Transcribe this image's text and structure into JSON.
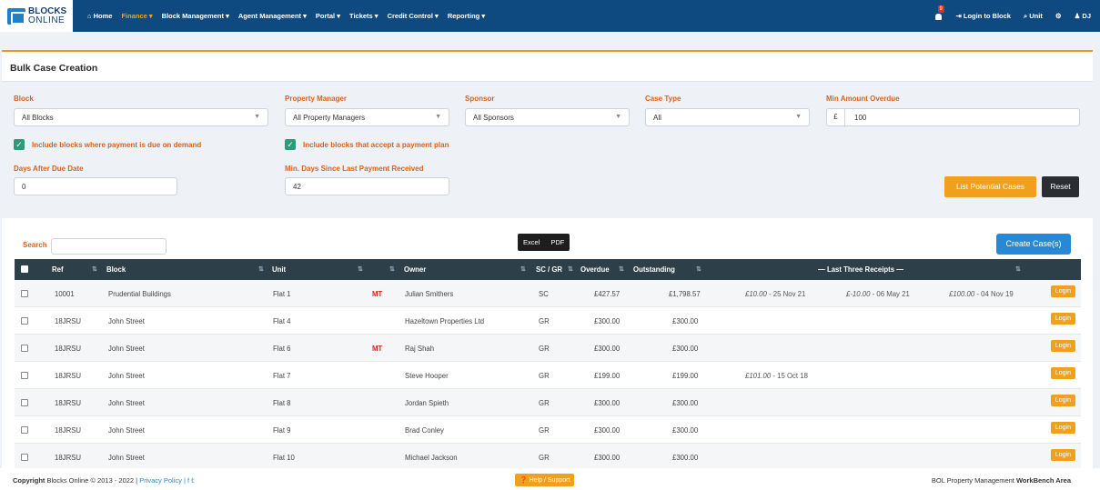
{
  "nav": {
    "logo_line1": "BLOCKS",
    "logo_line2": "ONLINE",
    "items": [
      "⌂ Home",
      "Finance ▾",
      "Block Management ▾",
      "Agent Management ▾",
      "Portal ▾",
      "Tickets ▾",
      "Credit Control ▾",
      "Reporting ▾"
    ],
    "notification_count": "9",
    "login_to_block": "⇥ Login to Block",
    "unit_search": "⌕ Unit",
    "settings": "⚙",
    "user": "♟ DJ"
  },
  "page": {
    "title": "Bulk Case Creation"
  },
  "filters": {
    "block_label": "Block",
    "block_value": "All Blocks",
    "pm_label": "Property Manager",
    "pm_value": "All Property Managers",
    "sponsor_label": "Sponsor",
    "sponsor_value": "All Sponsors",
    "case_type_label": "Case Type",
    "case_type_value": "All",
    "min_amount_label": "Min Amount Overdue",
    "currency": "£",
    "min_amount_value": "100",
    "check_demand": "Include blocks where payment is due on demand",
    "check_plan": "Include blocks that accept a payment plan",
    "days_due_label": "Days After Due Date",
    "days_due_value": "0",
    "min_days_label": "Min. Days Since Last Payment Received",
    "min_days_value": "42",
    "list_button": "List Potential Cases",
    "reset_button": "Reset"
  },
  "table_tools": {
    "search_label": "Search",
    "excel": "Excel",
    "pdf": "PDF",
    "create_button": "Create Case(s)"
  },
  "table": {
    "headers": {
      "ref": "Ref",
      "block": "Block",
      "unit": "Unit",
      "owner": "Owner",
      "scgr": "SC / GR",
      "overdue": "Overdue",
      "outstanding": "Outstanding",
      "receipts": "— Last Three Receipts —"
    },
    "login_label": "Login",
    "rows": [
      {
        "ref": "10001",
        "block": "Prudential Buildings",
        "unit": "Flat 1",
        "mt": "MT",
        "owner": "Julian Smithers",
        "scgr": "SC",
        "overdue": "£427.57",
        "outstanding": "£1,798.57",
        "r1a": "£10.00",
        "r1b": " - 25 Nov 21",
        "r2a": "£-10.00",
        "r2b": " - 06 May 21",
        "r3a": "£100.00",
        "r3b": " - 04 Nov 19"
      },
      {
        "ref": "18JRSU",
        "block": "John Street",
        "unit": "Flat 4",
        "mt": "",
        "owner": "Hazeltown Properties Ltd",
        "scgr": "GR",
        "overdue": "£300.00",
        "outstanding": "£300.00",
        "r1a": "",
        "r1b": "",
        "r2a": "",
        "r2b": "",
        "r3a": "",
        "r3b": ""
      },
      {
        "ref": "18JRSU",
        "block": "John Street",
        "unit": "Flat 6",
        "mt": "MT",
        "owner": "Raj Shah",
        "scgr": "GR",
        "overdue": "£300.00",
        "outstanding": "£300.00",
        "r1a": "",
        "r1b": "",
        "r2a": "",
        "r2b": "",
        "r3a": "",
        "r3b": ""
      },
      {
        "ref": "18JRSU",
        "block": "John Street",
        "unit": "Flat 7",
        "mt": "",
        "owner": "Steve Hooper",
        "scgr": "GR",
        "overdue": "£199.00",
        "outstanding": "£199.00",
        "r1a": "£101.00",
        "r1b": " - 15 Oct 18",
        "r2a": "",
        "r2b": "",
        "r3a": "",
        "r3b": ""
      },
      {
        "ref": "18JRSU",
        "block": "John Street",
        "unit": "Flat 8",
        "mt": "",
        "owner": "Jordan Spieth",
        "scgr": "GR",
        "overdue": "£300.00",
        "outstanding": "£300.00",
        "r1a": "",
        "r1b": "",
        "r2a": "",
        "r2b": "",
        "r3a": "",
        "r3b": ""
      },
      {
        "ref": "18JRSU",
        "block": "John Street",
        "unit": "Flat 9",
        "mt": "",
        "owner": "Brad Conley",
        "scgr": "GR",
        "overdue": "£300.00",
        "outstanding": "£300.00",
        "r1a": "",
        "r1b": "",
        "r2a": "",
        "r2b": "",
        "r3a": "",
        "r3b": ""
      },
      {
        "ref": "18JRSU",
        "block": "John Street",
        "unit": "Flat 10",
        "mt": "",
        "owner": "Michael Jackson",
        "scgr": "GR",
        "overdue": "£300.00",
        "outstanding": "£300.00",
        "r1a": "",
        "r1b": "",
        "r2a": "",
        "r2b": "",
        "r3a": "",
        "r3b": ""
      }
    ]
  },
  "footer": {
    "copyright_bold": "Copyright",
    "copyright_rest": " Blocks Online © 2013 - 2022 | ",
    "privacy": "Privacy Policy",
    "social": " | f 𝕥",
    "help": "❓ Help / Support",
    "right_normal": "BOL Property Management ",
    "right_bold": "WorkBench Area"
  }
}
